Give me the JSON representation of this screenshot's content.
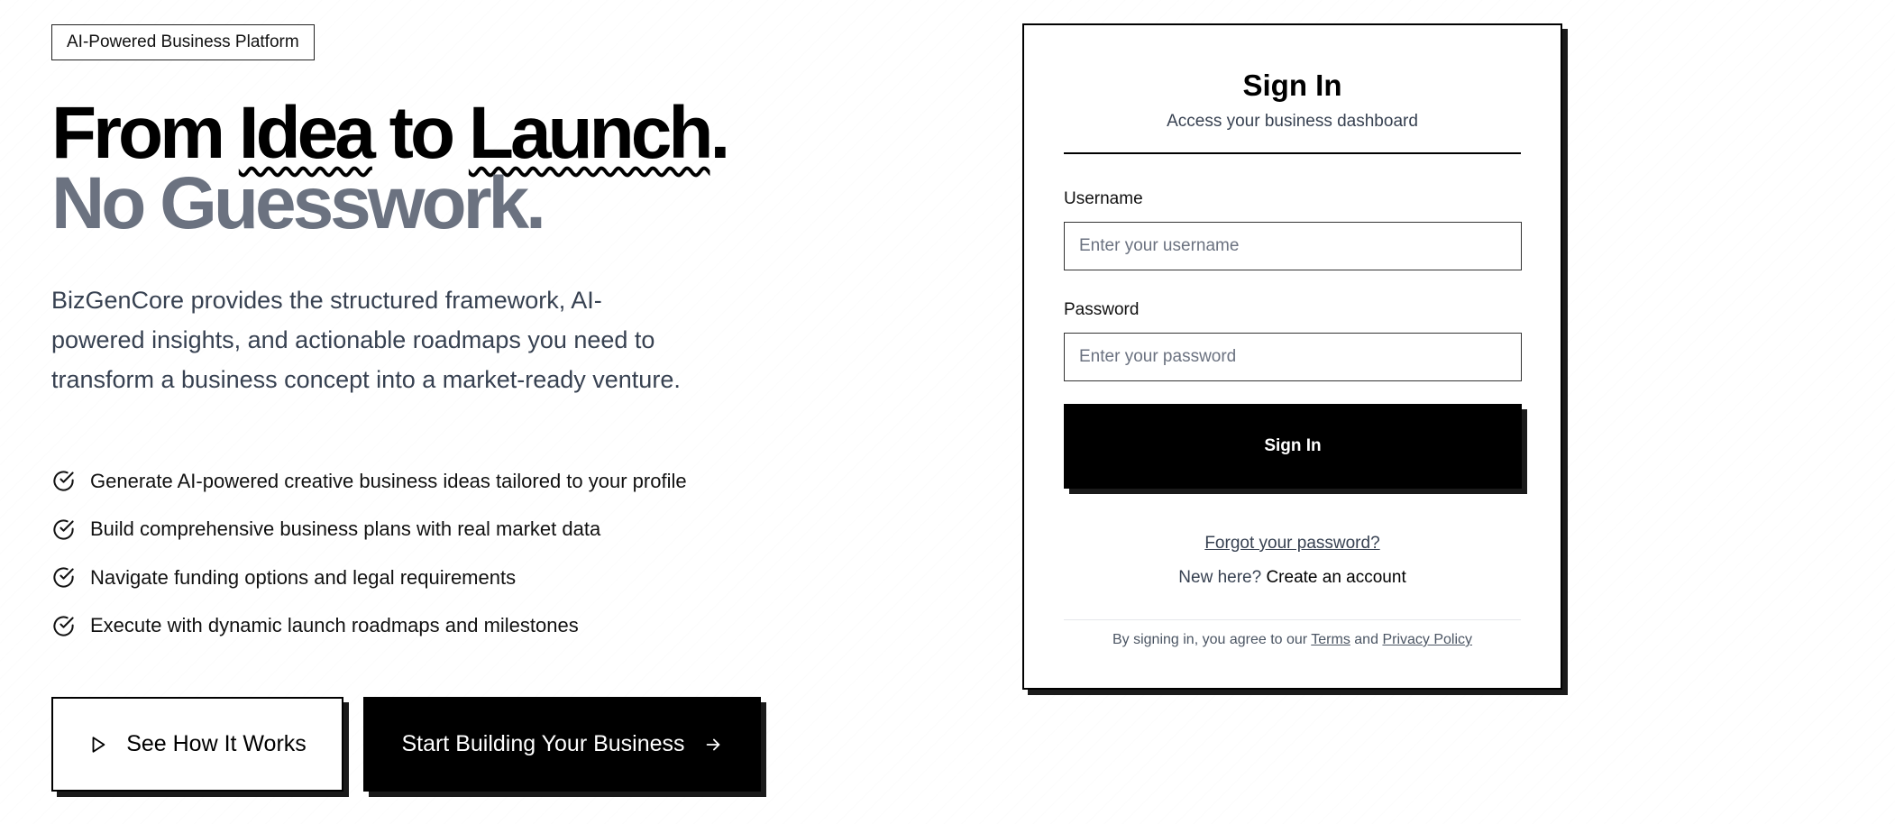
{
  "hero": {
    "badge": "AI-Powered Business Platform",
    "headline_from": "From ",
    "headline_idea": "Idea",
    "headline_to": " to ",
    "headline_launch": "Launch",
    "headline_period": ".",
    "headline_line2": "No Guesswork.",
    "lead": "BizGenCore provides the structured framework, AI-powered insights, and actionable roadmaps you need to transform a business concept into a market-ready venture.",
    "features": [
      "Generate AI-powered creative business ideas tailored to your profile",
      "Build comprehensive business plans with real market data",
      "Navigate funding options and legal requirements",
      "Execute with dynamic launch roadmaps and milestones"
    ],
    "cta_secondary": "See How It Works",
    "cta_primary": "Start Building Your Business"
  },
  "signin": {
    "title": "Sign In",
    "subtitle": "Access your business dashboard",
    "username_label": "Username",
    "username_placeholder": "Enter your username",
    "password_label": "Password",
    "password_placeholder": "Enter your password",
    "submit_label": "Sign In",
    "forgot_label": "Forgot your password?",
    "new_here": "New here?",
    "create_account": "Create an account",
    "legal_prefix": "By signing in, you agree to our",
    "terms": "Terms",
    "and": "and",
    "privacy": "Privacy Policy"
  },
  "icons": {
    "check": "check-circle-icon",
    "play": "play-icon",
    "arrow": "arrow-right-icon"
  },
  "colors": {
    "primary": "#000000",
    "muted_heading": "#6b7280",
    "body_text": "#374151",
    "background": "#ffffff"
  }
}
